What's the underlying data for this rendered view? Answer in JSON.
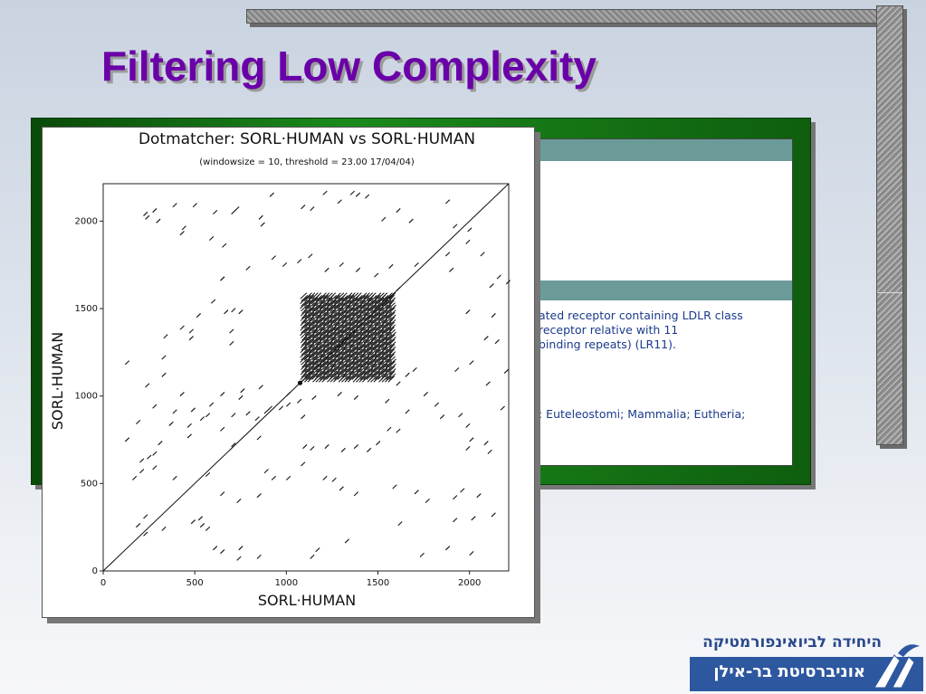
{
  "slide": {
    "title": "Filtering Low Complexity"
  },
  "document_panel": {
    "description_lines": [
      "ated receptor containing LDLR class",
      " receptor relative with 11",
      "binding repeats) (LR11)."
    ],
    "taxonomy_line": ": Euteleostomi; Mammalia; Eutheria;"
  },
  "logo": {
    "line1": "היחידה לביואינפורמטיקה",
    "line2": "אוניברסיטת בר-אילן"
  },
  "chart_data": {
    "type": "scatter",
    "title": "Dotmatcher: SORL·HUMAN vs SORL·HUMAN",
    "subtitle": "(windowsize = 10, threshold = 23.00  17/04/04)",
    "xlabel": "SORL·HUMAN",
    "ylabel": "SORL·HUMAN",
    "xlim": [
      0,
      2214
    ],
    "ylim": [
      0,
      2214
    ],
    "xticks": [
      0,
      500,
      1000,
      1500,
      2000
    ],
    "yticks": [
      0,
      500,
      1000,
      1500,
      2000
    ],
    "grid": false,
    "diagonal": [
      [
        0,
        0
      ],
      [
        2214,
        2214
      ]
    ],
    "highlight_point": [
      1075,
      1075
    ],
    "low_complexity_block": {
      "x_range": [
        1080,
        1560
      ],
      "y_range": [
        1080,
        1560
      ]
    },
    "series": [
      {
        "values": [
          [
            220,
            2030
          ],
          [
            230,
            2010
          ],
          [
            290,
            1990
          ],
          [
            270,
            2050
          ],
          [
            380,
            2080
          ],
          [
            420,
            1920
          ],
          [
            430,
            1950
          ],
          [
            490,
            2080
          ],
          [
            600,
            2040
          ],
          [
            580,
            1890
          ],
          [
            650,
            1850
          ],
          [
            700,
            2040
          ],
          [
            720,
            2060
          ],
          [
            850,
            2010
          ],
          [
            860,
            1970
          ],
          [
            910,
            2140
          ],
          [
            1080,
            2070
          ],
          [
            1130,
            2060
          ],
          [
            1200,
            2150
          ],
          [
            1280,
            2100
          ],
          [
            1350,
            2150
          ],
          [
            1380,
            2140
          ],
          [
            1430,
            2130
          ],
          [
            1520,
            2000
          ],
          [
            1600,
            2050
          ],
          [
            1670,
            1990
          ],
          [
            1870,
            2100
          ],
          [
            1910,
            1960
          ],
          [
            1990,
            1940
          ],
          [
            1980,
            1870
          ],
          [
            2060,
            1800
          ],
          [
            2150,
            1670
          ],
          [
            2200,
            1640
          ],
          [
            2110,
            1620
          ],
          [
            1890,
            1710
          ],
          [
            1870,
            1800
          ],
          [
            1700,
            1740
          ],
          [
            1600,
            1600
          ],
          [
            1560,
            1730
          ],
          [
            1480,
            1680
          ],
          [
            1380,
            1710
          ],
          [
            1290,
            1740
          ],
          [
            1210,
            1710
          ],
          [
            1120,
            1790
          ],
          [
            1060,
            1760
          ],
          [
            980,
            1740
          ],
          [
            920,
            1780
          ],
          [
            780,
            1720
          ],
          [
            640,
            1660
          ],
          [
            640,
            1660
          ],
          [
            590,
            1530
          ],
          [
            660,
            1470
          ],
          [
            700,
            1480
          ],
          [
            740,
            1470
          ],
          [
            690,
            1360
          ],
          [
            690,
            1290
          ],
          [
            510,
            1450
          ],
          [
            470,
            1360
          ],
          [
            470,
            1320
          ],
          [
            420,
            1380
          ],
          [
            330,
            1330
          ],
          [
            320,
            1210
          ],
          [
            320,
            1110
          ],
          [
            120,
            1180
          ],
          [
            180,
            840
          ],
          [
            120,
            740
          ],
          [
            200,
            620
          ],
          [
            270,
            580
          ],
          [
            240,
            640
          ],
          [
            270,
            660
          ],
          [
            300,
            720
          ],
          [
            460,
            760
          ],
          [
            460,
            820
          ],
          [
            360,
            830
          ],
          [
            640,
            800
          ],
          [
            700,
            710
          ],
          [
            700,
            880
          ],
          [
            840,
            750
          ],
          [
            830,
            860
          ],
          [
            880,
            900
          ],
          [
            900,
            920
          ],
          [
            1000,
            940
          ],
          [
            1060,
            960
          ],
          [
            1080,
            870
          ],
          [
            1090,
            700
          ],
          [
            1130,
            690
          ],
          [
            1210,
            700
          ],
          [
            1300,
            680
          ],
          [
            1370,
            700
          ],
          [
            1440,
            680
          ],
          [
            1490,
            720
          ],
          [
            1550,
            800
          ],
          [
            1600,
            790
          ],
          [
            1650,
            900
          ],
          [
            1750,
            1000
          ],
          [
            1810,
            940
          ],
          [
            1840,
            870
          ],
          [
            1940,
            880
          ],
          [
            1980,
            820
          ],
          [
            2000,
            740
          ],
          [
            1980,
            690
          ],
          [
            2080,
            720
          ],
          [
            2100,
            670
          ],
          [
            2170,
            920
          ],
          [
            2190,
            1130
          ],
          [
            2090,
            1060
          ],
          [
            2000,
            1180
          ],
          [
            2080,
            1320
          ],
          [
            2140,
            1300
          ],
          [
            1920,
            1140
          ],
          [
            1980,
            1470
          ],
          [
            2120,
            1450
          ],
          [
            1690,
            1140
          ],
          [
            1650,
            1110
          ],
          [
            1600,
            1060
          ],
          [
            1540,
            960
          ],
          [
            1370,
            980
          ],
          [
            1280,
            1000
          ],
          [
            1140,
            980
          ],
          [
            1000,
            1000
          ],
          [
            960,
            920
          ],
          [
            850,
            1040
          ],
          [
            750,
            1020
          ],
          [
            740,
            980
          ],
          [
            780,
            890
          ],
          [
            640,
            1000
          ],
          [
            580,
            940
          ],
          [
            560,
            880
          ],
          [
            530,
            860
          ],
          [
            480,
            910
          ],
          [
            420,
            1000
          ],
          [
            380,
            900
          ],
          [
            230,
            1050
          ],
          [
            270,
            930
          ],
          [
            200,
            560
          ],
          [
            160,
            520
          ],
          [
            380,
            520
          ],
          [
            560,
            540
          ],
          [
            640,
            430
          ],
          [
            730,
            390
          ],
          [
            840,
            420
          ],
          [
            880,
            560
          ],
          [
            920,
            520
          ],
          [
            1000,
            520
          ],
          [
            1080,
            600
          ],
          [
            1200,
            520
          ],
          [
            1250,
            510
          ],
          [
            1290,
            460
          ],
          [
            1370,
            430
          ],
          [
            1580,
            470
          ],
          [
            1700,
            440
          ],
          [
            1760,
            390
          ],
          [
            1950,
            450
          ],
          [
            2040,
            420
          ],
          [
            1910,
            410
          ],
          [
            1910,
            280
          ],
          [
            2120,
            310
          ],
          [
            2010,
            290
          ],
          [
            1610,
            260
          ],
          [
            1320,
            160
          ],
          [
            1160,
            110
          ],
          [
            1130,
            70
          ],
          [
            840,
            70
          ],
          [
            730,
            60
          ],
          [
            740,
            120
          ],
          [
            640,
            100
          ],
          [
            600,
            120
          ],
          [
            560,
            230
          ],
          [
            530,
            250
          ],
          [
            320,
            230
          ],
          [
            220,
            200
          ],
          [
            180,
            250
          ],
          [
            220,
            300
          ],
          [
            480,
            270
          ],
          [
            520,
            290
          ],
          [
            1730,
            80
          ],
          [
            1870,
            120
          ],
          [
            2000,
            90
          ]
        ]
      }
    ]
  }
}
